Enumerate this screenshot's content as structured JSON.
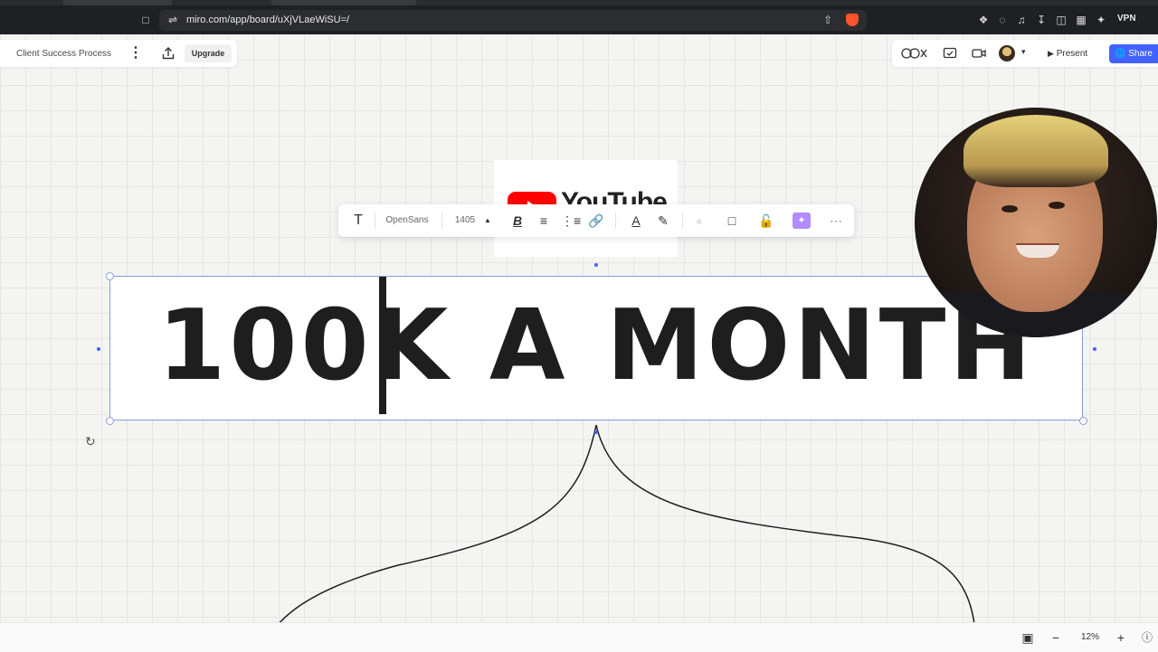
{
  "browser": {
    "url": "miro.com/app/board/uXjVLaeWiSU=/",
    "vpn_label": "VPN"
  },
  "board": {
    "name": "Client Success Process",
    "upgrade_label": "Upgrade"
  },
  "header_right": {
    "present_label": "Present",
    "share_label": "Share"
  },
  "youtube_card": {
    "logo_text": "YouTube"
  },
  "toolbar": {
    "font_name": "OpenSans",
    "font_size": "1405"
  },
  "canvas": {
    "main_text": "100K A MONTH"
  },
  "bottom_bar": {
    "zoom": "12%"
  },
  "colors": {
    "accent": "#4262ff",
    "ai_button": "#b18bff",
    "selection": "#8e9ad8",
    "connector": "#1e1e1e",
    "green_line": "#8fd14f"
  }
}
